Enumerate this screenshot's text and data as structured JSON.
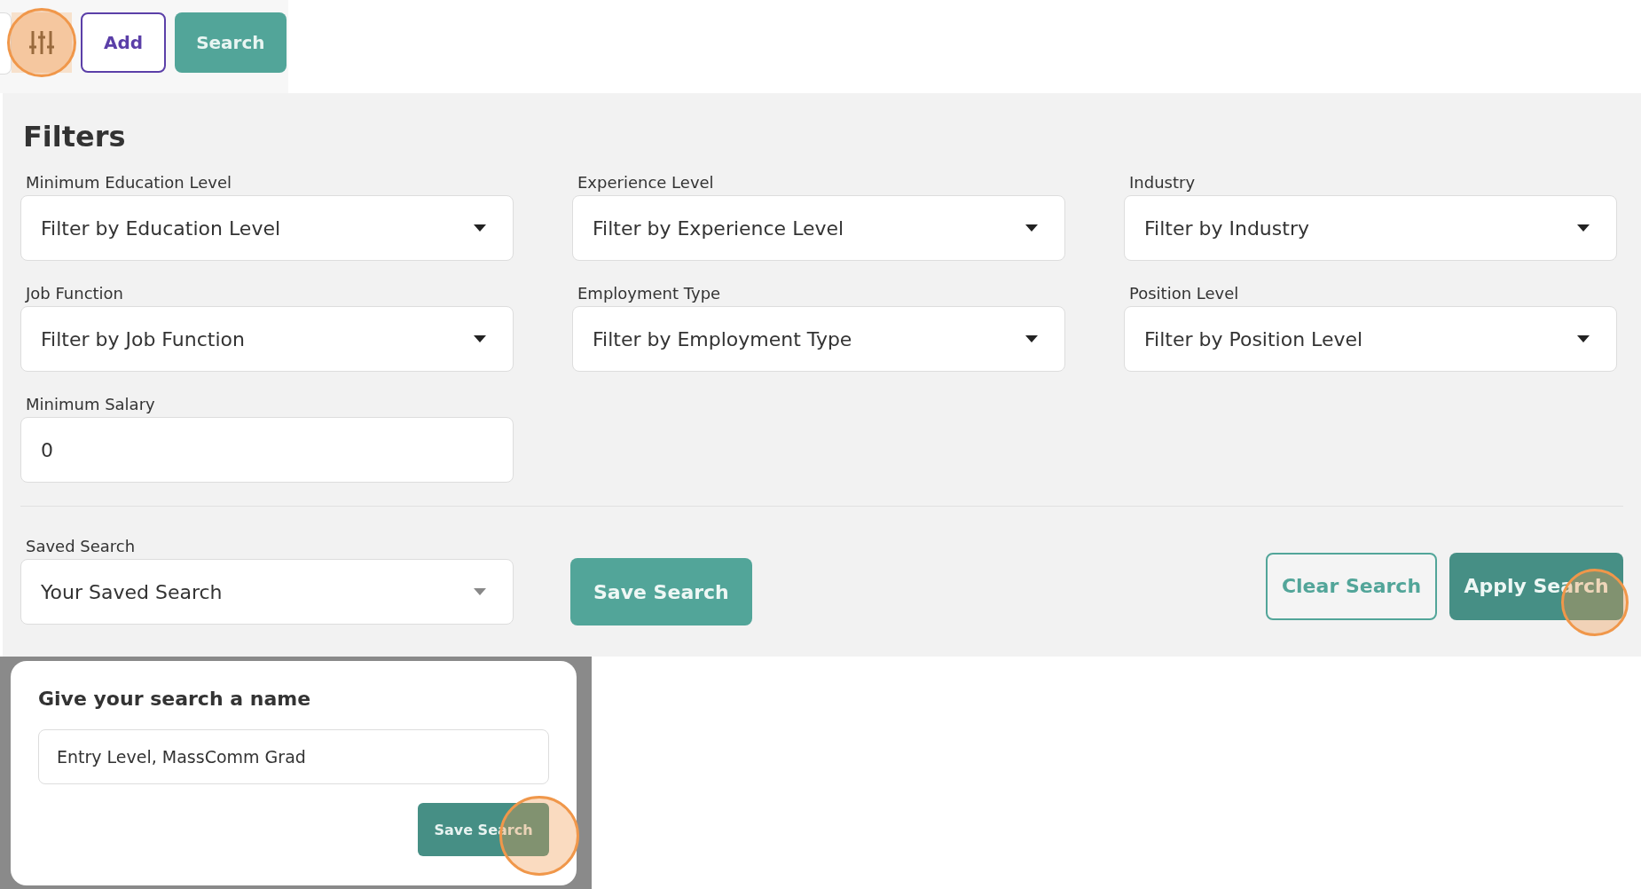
{
  "toolbar": {
    "filter_button": {
      "highlighted": true
    },
    "buttons": [
      {
        "label": "Add",
        "kind": "outline"
      },
      {
        "label": "Search",
        "kind": "primary"
      }
    ]
  },
  "filters": {
    "title": "Filters",
    "fields": [
      {
        "label": "Minimum Education Level",
        "text": "Filter by Education Level",
        "kind": "select"
      },
      {
        "label": "Experience Level",
        "text": "Filter by Experience Level",
        "kind": "select"
      },
      {
        "label": "Industry",
        "text": "Filter by Industry",
        "kind": "select"
      },
      {
        "label": "Job Function",
        "text": "Filter by Job Function",
        "kind": "select"
      },
      {
        "label": "Employment Type",
        "text": "Filter by Employment Type",
        "kind": "select"
      },
      {
        "label": "Position Level",
        "text": "Filter by Position Level",
        "kind": "select"
      },
      {
        "label": "Minimum Salary",
        "value": "0",
        "kind": "input"
      }
    ],
    "saved_search": {
      "label": "Saved Search",
      "text": "Your Saved Search"
    },
    "save_button": "Save Search",
    "actions": [
      {
        "label": "Clear Search",
        "kind": "outline",
        "highlighted": false
      },
      {
        "label": "Apply Search",
        "kind": "primary",
        "highlighted": true
      }
    ]
  },
  "dialog": {
    "title": "Give your search a name",
    "name_value": "Entry Level, MassComm Grad",
    "button": {
      "label": "Save Search",
      "highlighted": true
    }
  }
}
